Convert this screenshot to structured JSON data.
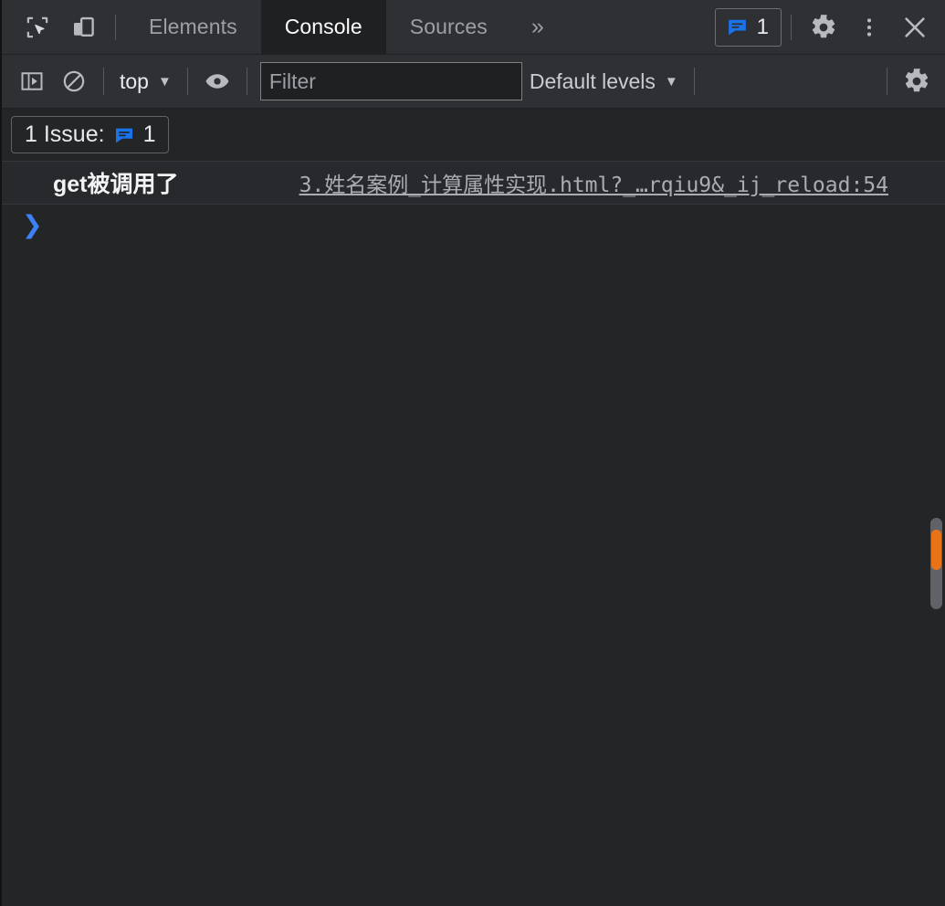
{
  "tabbar": {
    "inspect_icon": "inspect-element-icon",
    "device_icon": "device-toolbar-icon",
    "tabs": [
      {
        "label": "Elements",
        "active": false
      },
      {
        "label": "Console",
        "active": true
      },
      {
        "label": "Sources",
        "active": false
      }
    ],
    "more_tabs_label": "»",
    "issues_badge": {
      "icon": "issue-message-icon",
      "count": "1",
      "color": "#1a73e8"
    },
    "settings_icon": "gear-icon",
    "more_options_icon": "three-dot-menu-icon",
    "close_icon": "close-icon"
  },
  "console_toolbar": {
    "sidebar_toggle_icon": "console-sidebar-icon",
    "clear_icon": "clear-console-icon",
    "context": {
      "label": "top",
      "caret": "▼"
    },
    "eye_icon": "live-expression-eye-icon",
    "filter": {
      "placeholder": "Filter",
      "value": ""
    },
    "levels": {
      "label": "Default levels",
      "caret": "▼"
    },
    "settings_icon": "console-settings-gear-icon"
  },
  "issues_bar": {
    "label": "1 Issue:",
    "icon": "issue-message-icon",
    "count": "1"
  },
  "console": {
    "messages": [
      {
        "text": "get被调用了",
        "source": "3.姓名案例_计算属性实现.html?_…rqiu9&_ij_reload:54"
      }
    ],
    "prompt_caret": "❯",
    "prompt_value": ""
  },
  "colors": {
    "accent_blue": "#1a73e8",
    "prompt_blue": "#3b82f6",
    "scrollbar_marker": "#ea7317",
    "toolbar_bg": "#2f3033",
    "body_bg": "#242527",
    "active_tab_bg": "#1f2022"
  }
}
